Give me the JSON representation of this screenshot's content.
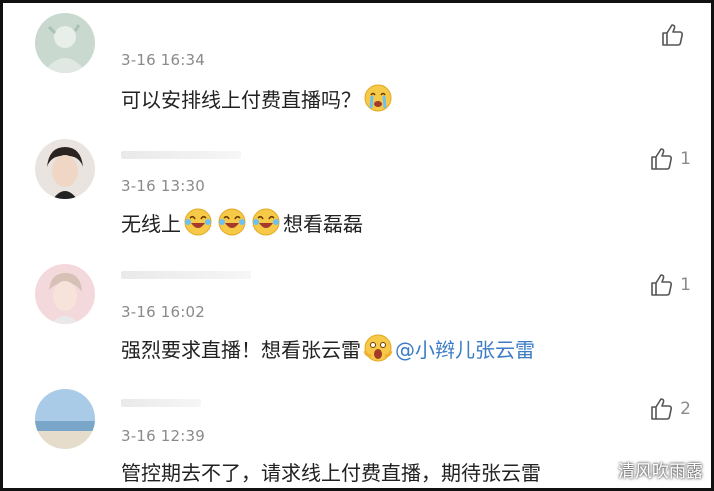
{
  "comments": [
    {
      "timestamp": "3-16 16:34",
      "text_parts": [
        "可以安排线上付费直播吗？"
      ],
      "likes": ""
    },
    {
      "timestamp": "3-16 13:30",
      "text_parts": [
        "无线上",
        "想看磊磊"
      ],
      "likes": "1"
    },
    {
      "timestamp": "3-16 16:02",
      "text_parts": [
        "强烈要求直播！想看张云雷"
      ],
      "mention": "@小辫儿张云雷",
      "likes": "1"
    },
    {
      "timestamp": "3-16 12:39",
      "text_parts": [
        "管控期去不了，请求线上付费直播，期待张云雷"
      ],
      "likes": "2"
    }
  ],
  "watermark": "清风吹雨露",
  "emojis": [
    "crying-emoji",
    "laugh-cry-emoji",
    "screaming-emoji"
  ],
  "colors": {
    "mention": "#3d7bc4",
    "timestamp": "#8a8a8a",
    "text": "#222222"
  }
}
